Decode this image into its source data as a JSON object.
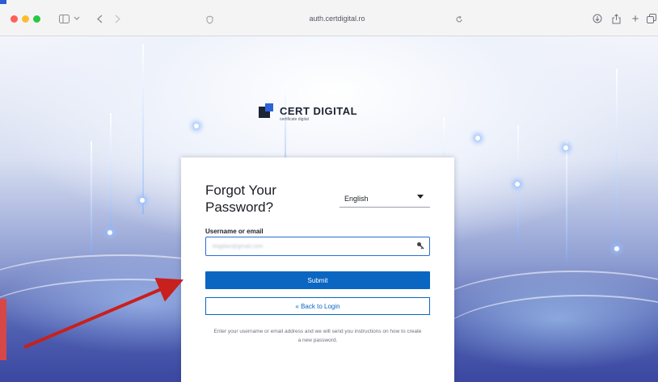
{
  "browser": {
    "url": "auth.certdigital.ro",
    "icons": [
      "sidebar-icon",
      "chevron-down-icon",
      "back-icon",
      "forward-icon",
      "shield-icon",
      "reload-icon",
      "download-icon",
      "share-icon",
      "new-tab-icon",
      "tabs-icon"
    ]
  },
  "logo": {
    "name": "CERT DIGITAL",
    "tagline": "certificate digital"
  },
  "form": {
    "title": "Forgot Your Password?",
    "language": "English",
    "username_label": "Username or email",
    "username_value": "bogdan@gmail.com",
    "submit_label": "Submit",
    "back_label": "« Back to Login",
    "help_text": "Enter your username or email address and we will send you instructions on how to create a new password."
  },
  "colors": {
    "primary": "#0b66c2",
    "brand_blue": "#2c63d9",
    "annotation_red": "#c8201d"
  }
}
